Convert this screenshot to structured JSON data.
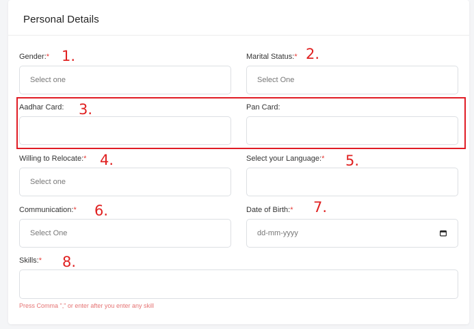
{
  "section": {
    "title": "Personal Details"
  },
  "fields": {
    "gender": {
      "label": "Gender:",
      "required": "*",
      "placeholder": "Select one",
      "annotation": "1."
    },
    "marital_status": {
      "label": "Marital Status:",
      "required": "*",
      "placeholder": "Select One",
      "annotation": "2."
    },
    "aadhar": {
      "label": "Aadhar Card:",
      "value": "",
      "annotation": "3."
    },
    "pan": {
      "label": "Pan Card:",
      "value": ""
    },
    "relocate": {
      "label": "Willing to Relocate:",
      "required": "*",
      "placeholder": "Select one",
      "annotation": "4."
    },
    "language": {
      "label": "Select your Language:",
      "required": "*",
      "value": "",
      "annotation": "5."
    },
    "communication": {
      "label": "Communication:",
      "required": "*",
      "placeholder": "Select One",
      "annotation": "6."
    },
    "dob": {
      "label": "Date of Birth:",
      "required": "*",
      "placeholder": "dd-mm-yyyy",
      "annotation": "7."
    },
    "skills": {
      "label": "Skills:",
      "required": "*",
      "value": "",
      "annotation": "8.",
      "hint": "Press Comma \",\" or enter after you enter any skill"
    }
  },
  "colors": {
    "annotation": "#e02020",
    "required": "#e53935",
    "hint": "#e57373",
    "highlight_box": "#e01b24"
  }
}
